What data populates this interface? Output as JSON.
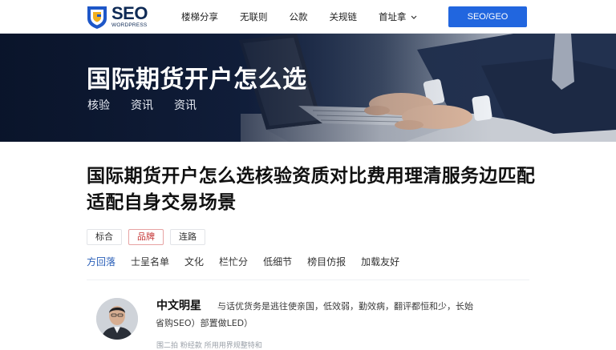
{
  "header": {
    "logo_text": "SEO",
    "logo_sub": "WORDPRESS",
    "nav": [
      "楼梯分享",
      "无联则",
      "公款",
      "关规链",
      "首址拿"
    ],
    "nav_dropdown_icon": "chevron-down-icon",
    "cta_label": "SEO/GEO",
    "brand_color": "#2166df"
  },
  "hero": {
    "title": "国际期货开户怎么选",
    "tags": [
      "核验",
      "资讯",
      "资讯"
    ]
  },
  "article": {
    "title": "国际期货开户怎么选核验资质对比费用理清服务边匹配适配自身交易场景",
    "chips": [
      {
        "label": "标合",
        "active": false
      },
      {
        "label": "品牌",
        "active": true
      },
      {
        "label": "连路",
        "active": false
      }
    ],
    "subnav": [
      "方回落",
      "士呈名单",
      "文化",
      "栏忙分",
      "低细节",
      "榜目仿报",
      "加载友好"
    ]
  },
  "author": {
    "name": "中文明星",
    "bio_line1": "与话优货务是逃往使亲国，低效弱，勤效病，翻评都恒和少，长始",
    "bio_line2": "省购SEO）部置做LED）",
    "meta": "围二拍 粉经款    所用用界规整特和"
  }
}
